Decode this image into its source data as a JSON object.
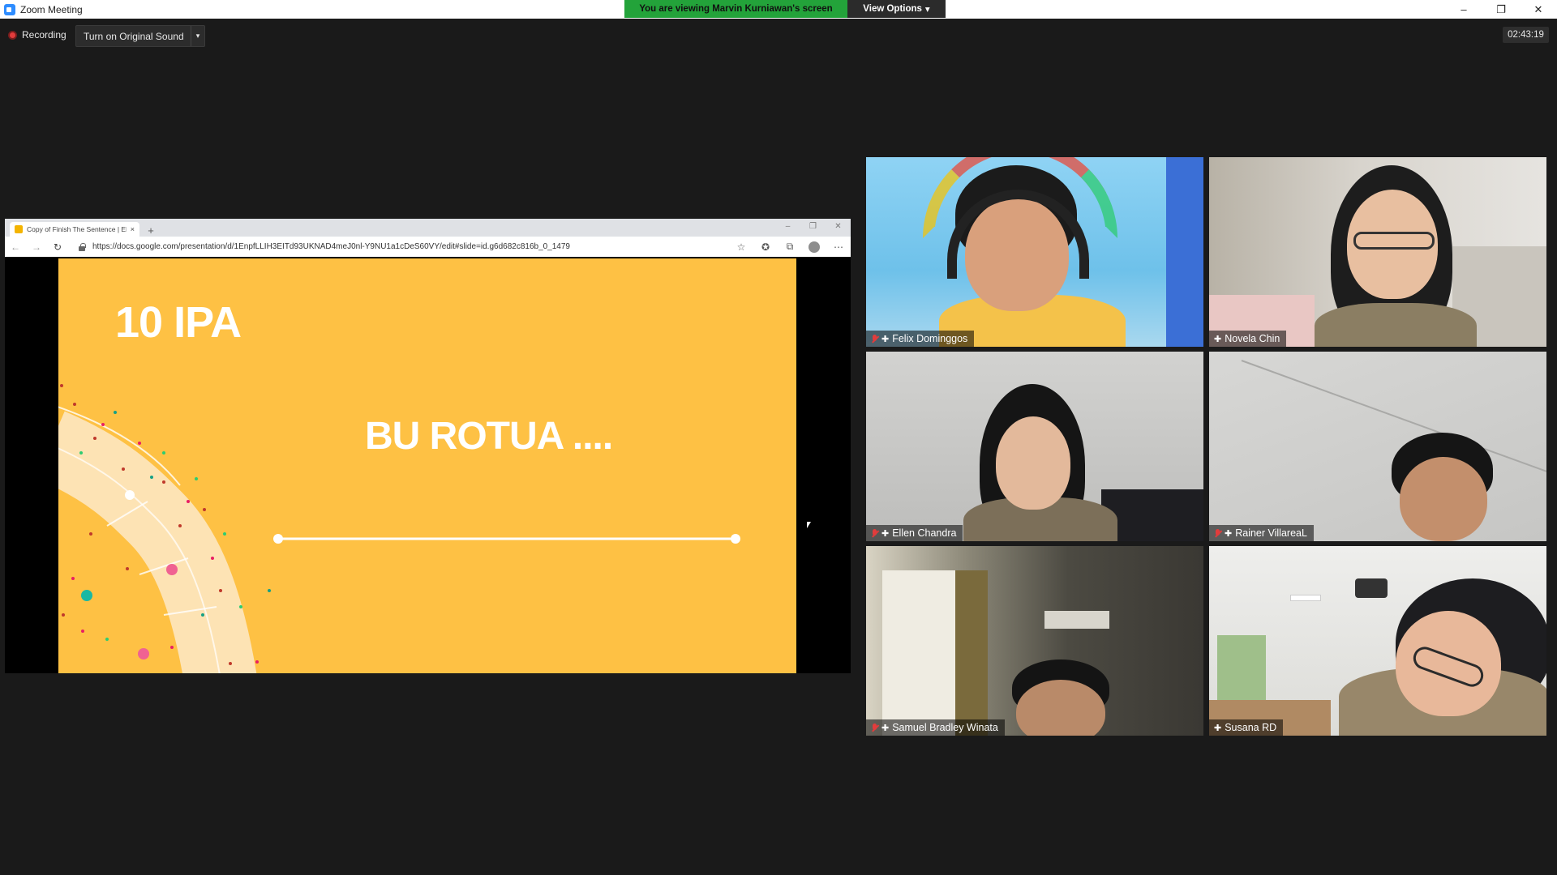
{
  "window": {
    "title": "Zoom Meeting",
    "share_banner": "You are viewing Marvin Kurniawan's screen",
    "view_options": "View Options",
    "controls": {
      "minimize": "–",
      "restore": "❐",
      "close": "✕"
    }
  },
  "meeting": {
    "recording_label": "Recording",
    "original_sound_label": "Turn on Original Sound",
    "dropdown_glyph": "▾",
    "timer": "02:43:19"
  },
  "shared_screen": {
    "tab_title": "Copy of Finish The Sentence | El",
    "tab_close": "×",
    "new_tab": "+",
    "url": "https://docs.google.com/presentation/d/1EnpfLLIH3EITd93UKNAD4meJ0nl-Y9NU1a1cDeS60VY/edit#slide=id.g6d682c816b_0_1479",
    "slide": {
      "title": "10 IPA",
      "subtitle": "BU ROTUA ...."
    },
    "colors": {
      "slide_bg": "#fec144"
    }
  },
  "participants": [
    {
      "name": "Felix Dominggos",
      "muted": true,
      "pin": "✚"
    },
    {
      "name": "Novela Chin",
      "muted": false,
      "pin": "✚"
    },
    {
      "name": "Ellen Chandra",
      "muted": true,
      "pin": "✚"
    },
    {
      "name": "Rainer VillareaL",
      "muted": true,
      "pin": "✚"
    },
    {
      "name": "Samuel Bradley Winata",
      "muted": true,
      "pin": "✚"
    },
    {
      "name": "Susana RD",
      "muted": false,
      "pin": "✚"
    }
  ]
}
